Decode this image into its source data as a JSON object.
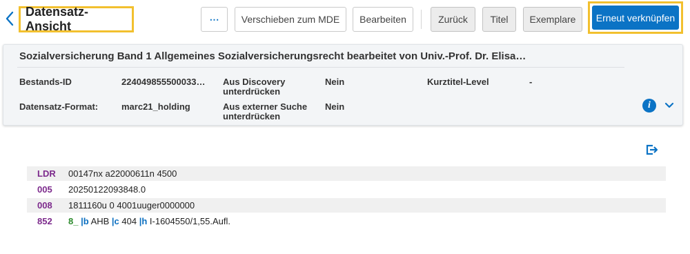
{
  "header": {
    "title": "Datensatz-Ansicht",
    "more_label": "⋯",
    "move_label": "Verschieben zum MDE",
    "edit_label": "Bearbeiten",
    "back_label": "Zurück",
    "title_btn_label": "Titel",
    "items_label": "Exemplare",
    "relink_label": "Erneut verknüpfen"
  },
  "panel": {
    "title": "Sozialversicherung Band 1 Allgemeines Sozialversicherungsrecht bearbeitet von Univ.-Prof. Dr. Elisa…",
    "fields": {
      "holdings_id_label": "Bestands-ID",
      "holdings_id_value": "224049855500033…",
      "suppress_discovery_label_1": "Aus Discovery",
      "suppress_discovery_label_2": "unterdrücken",
      "suppress_discovery_value": "Nein",
      "brief_level_label": "Kurztitel-Level",
      "brief_level_value": "-",
      "record_format_label": "Datensatz-Format:",
      "record_format_value": "marc21_holding",
      "suppress_external_label_1": "Aus externer Suche",
      "suppress_external_label_2": "unterdrücken",
      "suppress_external_value": "Nein"
    }
  },
  "marc": {
    "ldr_tag": "LDR",
    "ldr_value": "00147nx a22000611n 4500",
    "f005_tag": "005",
    "f005_value": "20250122093848.0",
    "f008_tag": "008",
    "f008_value": "1811160u 0 4001uuger0000000",
    "f852_tag": "852",
    "f852_ind": "8_",
    "f852_b_code": "|b",
    "f852_b_value": " AHB ",
    "f852_c_code": "|c",
    "f852_c_value": " 404 ",
    "f852_h_code": "|h",
    "f852_h_value": " I-1604550/1,55.Aufl."
  },
  "colors": {
    "accent_blue": "#0b73c5",
    "highlight_yellow": "#f2c02e",
    "tag_purple": "#7c2a8c",
    "indicator_green": "#2c8a2c"
  },
  "icons": {
    "back": "chevron-left-icon",
    "more": "more-horizontal-icon",
    "info": "info-icon",
    "expand": "chevron-down-icon",
    "export": "export-icon"
  }
}
